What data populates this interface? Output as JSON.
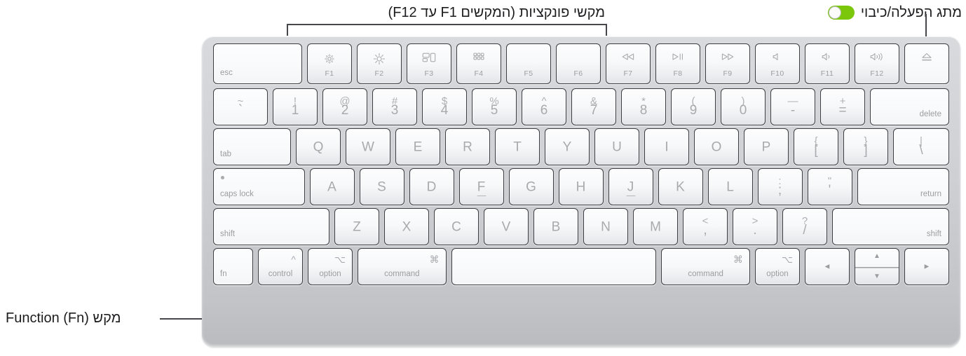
{
  "annotations": {
    "function_keys": "מקשי פונקציות (המקשים F1 עד F12)",
    "power_button": "מתג הפעלה/כיבוי",
    "fn_key": "מקש Function (Fn)",
    "toggle_color": "#7ac70c"
  },
  "keyboard": {
    "rows": [
      {
        "name": "function-row",
        "keys": [
          {
            "name": "esc",
            "label_bl": "esc"
          },
          {
            "name": "f1",
            "icon": "brightness-down-icon",
            "flabel": "F1"
          },
          {
            "name": "f2",
            "icon": "brightness-up-icon",
            "flabel": "F2"
          },
          {
            "name": "f3",
            "icon": "mission-control-icon",
            "flabel": "F3"
          },
          {
            "name": "f4",
            "icon": "launchpad-icon",
            "flabel": "F4"
          },
          {
            "name": "f5",
            "icon": "",
            "flabel": "F5"
          },
          {
            "name": "f6",
            "icon": "",
            "flabel": "F6"
          },
          {
            "name": "f7",
            "icon": "rewind-icon",
            "flabel": "F7"
          },
          {
            "name": "f8",
            "icon": "play-pause-icon",
            "flabel": "F8"
          },
          {
            "name": "f9",
            "icon": "fast-forward-icon",
            "flabel": "F9"
          },
          {
            "name": "f10",
            "icon": "mute-icon",
            "flabel": "F10"
          },
          {
            "name": "f11",
            "icon": "volume-down-icon",
            "flabel": "F11"
          },
          {
            "name": "f12",
            "icon": "volume-up-icon",
            "flabel": "F12"
          },
          {
            "name": "eject",
            "icon": "eject-icon"
          }
        ]
      },
      {
        "name": "number-row",
        "keys": [
          {
            "name": "grave",
            "up": "~",
            "lo": "`"
          },
          {
            "name": "digit-1",
            "up": "!",
            "lo": "1"
          },
          {
            "name": "digit-2",
            "up": "@",
            "lo": "2"
          },
          {
            "name": "digit-3",
            "up": "#",
            "lo": "3"
          },
          {
            "name": "digit-4",
            "up": "$",
            "lo": "4"
          },
          {
            "name": "digit-5",
            "up": "%",
            "lo": "5"
          },
          {
            "name": "digit-6",
            "up": "^",
            "lo": "6"
          },
          {
            "name": "digit-7",
            "up": "&",
            "lo": "7"
          },
          {
            "name": "digit-8",
            "up": "*",
            "lo": "8"
          },
          {
            "name": "digit-9",
            "up": "(",
            "lo": "9"
          },
          {
            "name": "digit-0",
            "up": ")",
            "lo": "0"
          },
          {
            "name": "minus",
            "up": "—",
            "lo": "-"
          },
          {
            "name": "equals",
            "up": "+",
            "lo": "="
          },
          {
            "name": "delete",
            "label_br": "delete"
          }
        ]
      },
      {
        "name": "qwerty-row",
        "keys": [
          {
            "name": "tab",
            "label_bl": "tab"
          },
          {
            "name": "key-q",
            "letter": "Q"
          },
          {
            "name": "key-w",
            "letter": "W"
          },
          {
            "name": "key-e",
            "letter": "E"
          },
          {
            "name": "key-r",
            "letter": "R"
          },
          {
            "name": "key-t",
            "letter": "T"
          },
          {
            "name": "key-y",
            "letter": "Y"
          },
          {
            "name": "key-u",
            "letter": "U"
          },
          {
            "name": "key-i",
            "letter": "I"
          },
          {
            "name": "key-o",
            "letter": "O"
          },
          {
            "name": "key-p",
            "letter": "P"
          },
          {
            "name": "bracket-left",
            "up": "{",
            "lo": "["
          },
          {
            "name": "bracket-right",
            "up": "}",
            "lo": "]"
          },
          {
            "name": "backslash",
            "up": "|",
            "lo": "\\"
          }
        ]
      },
      {
        "name": "home-row",
        "keys": [
          {
            "name": "caps-lock",
            "label_bl": "caps lock",
            "led": true
          },
          {
            "name": "key-a",
            "letter": "A"
          },
          {
            "name": "key-s",
            "letter": "S"
          },
          {
            "name": "key-d",
            "letter": "D"
          },
          {
            "name": "key-f",
            "letter": "F",
            "homing": true
          },
          {
            "name": "key-g",
            "letter": "G"
          },
          {
            "name": "key-h",
            "letter": "H"
          },
          {
            "name": "key-j",
            "letter": "J",
            "homing": true
          },
          {
            "name": "key-k",
            "letter": "K"
          },
          {
            "name": "key-l",
            "letter": "L"
          },
          {
            "name": "semicolon",
            "up": ":",
            "lo": ";"
          },
          {
            "name": "quote",
            "up": "\"",
            "lo": "'"
          },
          {
            "name": "return",
            "label_br": "return"
          }
        ]
      },
      {
        "name": "shift-row",
        "keys": [
          {
            "name": "shift-left",
            "label_bl": "shift"
          },
          {
            "name": "key-z",
            "letter": "Z"
          },
          {
            "name": "key-x",
            "letter": "X"
          },
          {
            "name": "key-c",
            "letter": "C"
          },
          {
            "name": "key-v",
            "letter": "V"
          },
          {
            "name": "key-b",
            "letter": "B"
          },
          {
            "name": "key-n",
            "letter": "N"
          },
          {
            "name": "key-m",
            "letter": "M"
          },
          {
            "name": "comma",
            "up": "<",
            "lo": ","
          },
          {
            "name": "period",
            "up": ">",
            "lo": "."
          },
          {
            "name": "slash",
            "up": "?",
            "lo": "/"
          },
          {
            "name": "shift-right",
            "label_br": "shift"
          }
        ]
      },
      {
        "name": "bottom-row",
        "keys": [
          {
            "name": "fn",
            "label_bl": "fn"
          },
          {
            "name": "control-left",
            "symbol": "^",
            "label_bc": "control"
          },
          {
            "name": "option-left",
            "symbol": "⌥",
            "label_bc": "option"
          },
          {
            "name": "command-left",
            "symbol": "⌘",
            "label_bc": "command"
          },
          {
            "name": "space"
          },
          {
            "name": "command-right",
            "symbol": "⌘",
            "label_bc": "command"
          },
          {
            "name": "option-right",
            "symbol": "⌥",
            "label_bc": "option"
          },
          {
            "name": "arrow-left",
            "arrow": "◄"
          },
          {
            "name": "arrow-updown",
            "arrow_up": "▲",
            "arrow_down": "▼"
          },
          {
            "name": "arrow-right",
            "arrow": "►"
          }
        ]
      }
    ]
  }
}
